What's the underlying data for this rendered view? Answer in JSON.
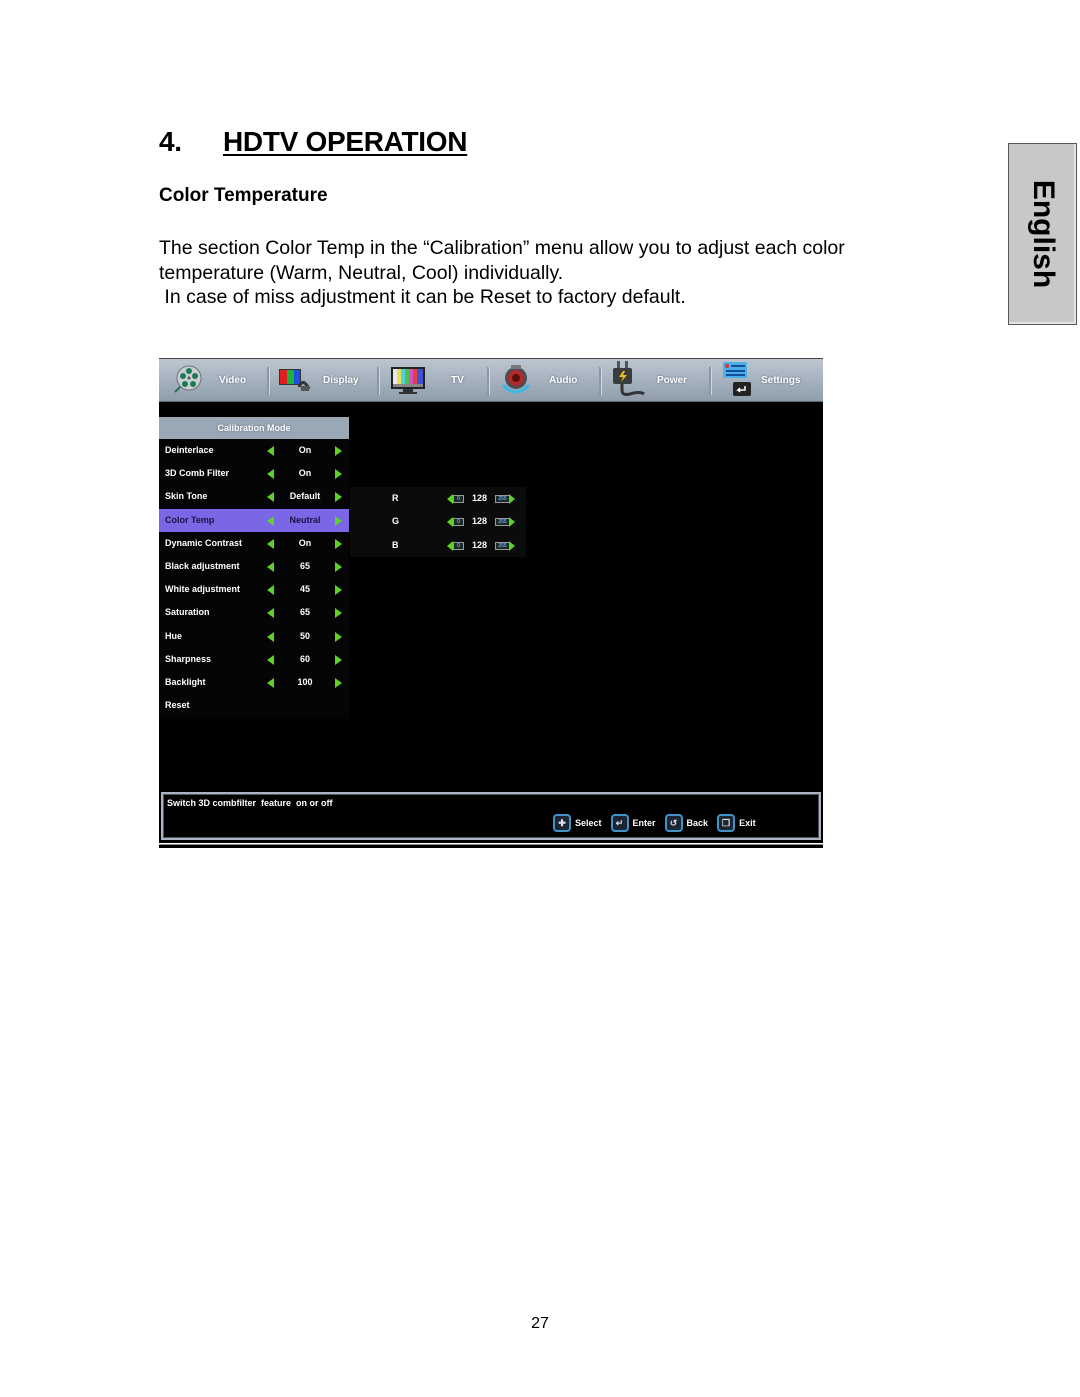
{
  "page": {
    "chapter_number": "4.",
    "chapter_title": "HDTV OPERATION",
    "section_title": "Color Temperature",
    "paragraphs": [
      "The section Color Temp in the “Calibration” menu allow you to adjust each color",
      "temperature (Warm, Neutral, Cool) individually.",
      " In case of miss adjustment it can be Reset to factory default."
    ],
    "language_tab": "English",
    "page_number": "27"
  },
  "osd": {
    "tabs": [
      {
        "label": "Video",
        "icon": "film-reel-icon"
      },
      {
        "label": "Display",
        "icon": "display-rgb-icon"
      },
      {
        "label": "TV",
        "icon": "tv-color-bars-icon"
      },
      {
        "label": "Audio",
        "icon": "speaker-icon"
      },
      {
        "label": "Power",
        "icon": "power-plug-icon"
      },
      {
        "label": "Settings",
        "icon": "settings-list-icon"
      }
    ],
    "menu_title": "Calibration Mode",
    "menu_items": [
      {
        "name": "Deinterlace",
        "value": "On",
        "arrows": true
      },
      {
        "name": "3D Comb Filter",
        "value": "On",
        "arrows": true
      },
      {
        "name": "Skin Tone",
        "value": "Default",
        "arrows": true
      },
      {
        "name": "Color Temp",
        "value": "Neutral",
        "arrows": true,
        "selected": true
      },
      {
        "name": "Dynamic Contrast",
        "value": "On",
        "arrows": true
      },
      {
        "name": "Black adjustment",
        "value": "65",
        "arrows": true
      },
      {
        "name": "White adjustment",
        "value": "45",
        "arrows": true
      },
      {
        "name": "Saturation",
        "value": "65",
        "arrows": true
      },
      {
        "name": "Hue",
        "value": "50",
        "arrows": true
      },
      {
        "name": "Sharpness",
        "value": "60",
        "arrows": true
      },
      {
        "name": "Backlight",
        "value": "100",
        "arrows": true
      },
      {
        "name": "Reset",
        "value": "",
        "arrows": false
      }
    ],
    "rgb_gains": [
      {
        "channel": "R",
        "value": "128",
        "min": "0",
        "max": "255"
      },
      {
        "channel": "G",
        "value": "128",
        "min": "0",
        "max": "255"
      },
      {
        "channel": "B",
        "value": "128",
        "min": "0",
        "max": "255"
      }
    ],
    "help_text": "Switch 3D combfilter  feature  on or off",
    "keys": [
      {
        "label": "Select",
        "icon": "dpad-icon",
        "glyph": "✚"
      },
      {
        "label": "Enter",
        "icon": "enter-key-icon",
        "glyph": "↵"
      },
      {
        "label": "Back",
        "icon": "back-arrow-icon",
        "glyph": "↺"
      },
      {
        "label": "Exit",
        "icon": "exit-icon",
        "glyph": "❐"
      }
    ],
    "colors": {
      "highlight": "#7b67e6",
      "arrow": "#5ed12a",
      "header": "#9aa8b5"
    }
  }
}
